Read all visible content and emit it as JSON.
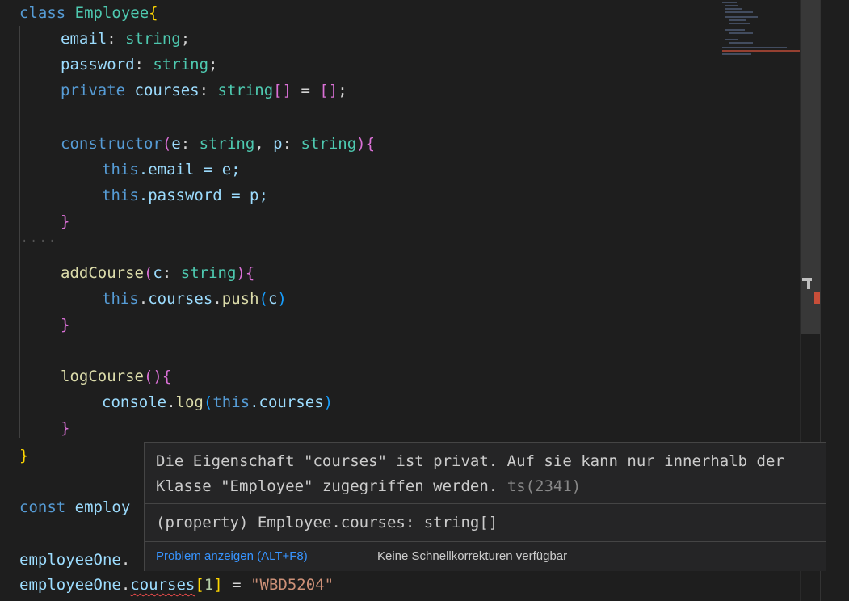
{
  "code": {
    "line1": {
      "kw": "class",
      "name": "Employee",
      "brace": "{"
    },
    "line2": {
      "prop": "email",
      "colon": ": ",
      "type": "string",
      "semi": ";"
    },
    "line3": {
      "prop": "password",
      "colon": ": ",
      "type": "string",
      "semi": ";"
    },
    "line4": {
      "kw": "private",
      "prop": "courses",
      "colon": ": ",
      "type": "string",
      "arr": "[]",
      "eq": " = ",
      "init": "[]",
      "semi": ";"
    },
    "line6": {
      "fn": "constructor",
      "open": "(",
      "p1": "e",
      "c1": ": ",
      "t1": "string",
      "comma": ", ",
      "p2": "p",
      "c2": ": ",
      "t2": "string",
      "close": ")",
      "brace": "{"
    },
    "line7": {
      "this": "this",
      "rest": ".email = e;"
    },
    "line8": {
      "this": "this",
      "rest": ".password = p;"
    },
    "line9": {
      "brace": "}"
    },
    "line11": {
      "fn": "addCourse",
      "open": "(",
      "p": "c",
      "c": ": ",
      "t": "string",
      "close": ")",
      "brace": "{"
    },
    "line12": {
      "this": "this",
      "dot1": ".",
      "prop": "courses",
      "dot2": ".",
      "fn": "push",
      "open": "(",
      "arg": "c",
      "close": ")"
    },
    "line13": {
      "brace": "}"
    },
    "line15": {
      "fn": "logCourse",
      "parens": "()",
      "brace": "{"
    },
    "line16": {
      "obj": "console",
      "dot": ".",
      "fn": "log",
      "open": "(",
      "this": "this",
      "rest": ".courses",
      "close": ")"
    },
    "line17": {
      "brace": "}"
    },
    "line18": {
      "brace": "}"
    },
    "line20": {
      "kw": "const",
      "rest": "employ"
    },
    "line22": {
      "obj": "employeeOne",
      "dot": "."
    },
    "line23": {
      "obj": "employeeOne",
      "dot": ".",
      "prop": "courses",
      "open": "[",
      "index": "1",
      "close": "]",
      "eq": " = ",
      "str": "\"WBD5204\""
    }
  },
  "hover": {
    "message": "Die Eigenschaft \"courses\" ist privat. Auf sie kann nur innerhalb der Klasse \"Employee\" zugegriffen werden. ",
    "error_code": "ts(2341)",
    "signature": "(property) Employee.courses: string[]",
    "view_problem": "Problem anzeigen (ALT+F8)",
    "no_quickfix": "Keine Schnellkorrekturen verfügbar"
  },
  "colors": {
    "error": "#f14c4c",
    "link": "#3794ff"
  }
}
